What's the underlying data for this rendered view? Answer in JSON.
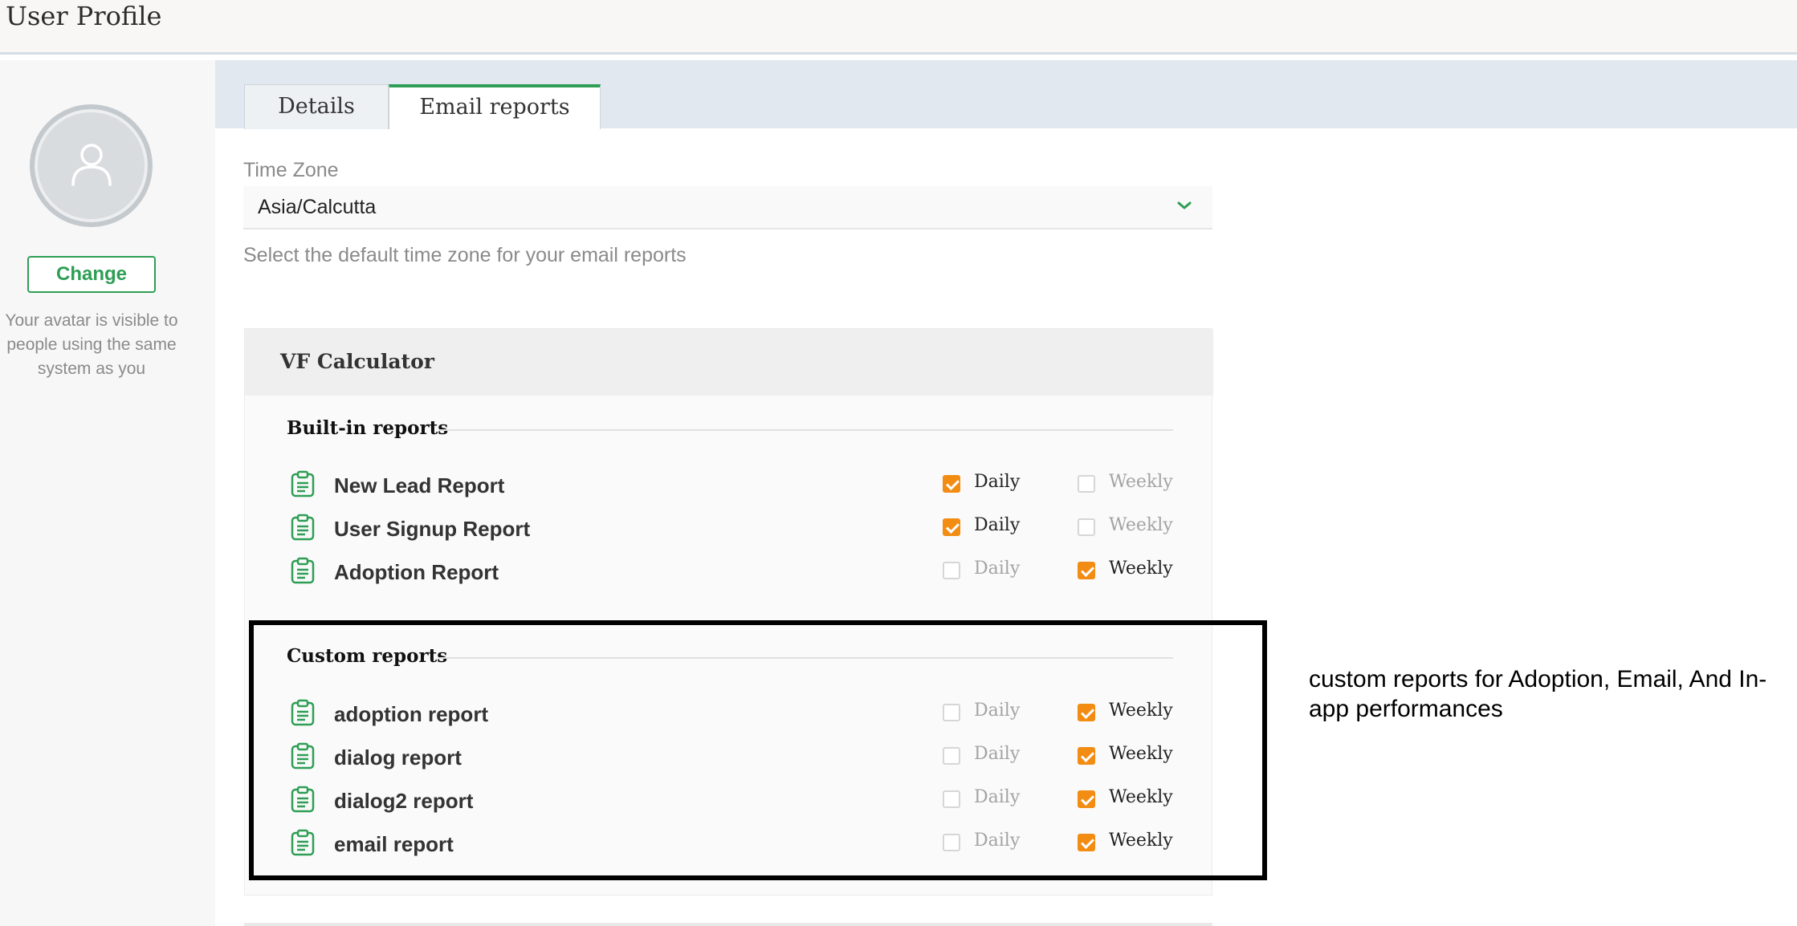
{
  "header": {
    "title": "User Profile"
  },
  "avatar": {
    "change_label": "Change",
    "note": "Your avatar is visible to people using the same system as you"
  },
  "tabs": [
    {
      "label": "Details",
      "active": false
    },
    {
      "label": "Email reports",
      "active": true
    }
  ],
  "timezone": {
    "label": "Time Zone",
    "value": "Asia/Calcutta",
    "help": "Select the default time zone for your email reports"
  },
  "card": {
    "title": "VF Calculator",
    "sections": [
      {
        "title": "Built-in reports",
        "rows": [
          {
            "name": "New Lead Report",
            "daily": true,
            "weekly": false
          },
          {
            "name": "User Signup Report",
            "daily": true,
            "weekly": false
          },
          {
            "name": "Adoption Report",
            "daily": false,
            "weekly": true
          }
        ]
      },
      {
        "title": "Custom reports",
        "rows": [
          {
            "name": "adoption report",
            "daily": false,
            "weekly": true
          },
          {
            "name": "dialog report",
            "daily": false,
            "weekly": true
          },
          {
            "name": "dialog2 report",
            "daily": false,
            "weekly": true
          },
          {
            "name": "email report",
            "daily": false,
            "weekly": true
          }
        ]
      }
    ],
    "daily_label": "Daily",
    "weekly_label": "Weekly"
  },
  "annotation": {
    "text": "custom reports for Adoption, Email, And In-app performances"
  },
  "colors": {
    "accent_green": "#2e9e55",
    "checkbox_orange": "#f28c12",
    "tabs_bar": "#e1e8ef"
  },
  "icons": {
    "avatar": "user-icon",
    "report": "clipboard-icon",
    "dropdown": "chevron-down-icon"
  }
}
